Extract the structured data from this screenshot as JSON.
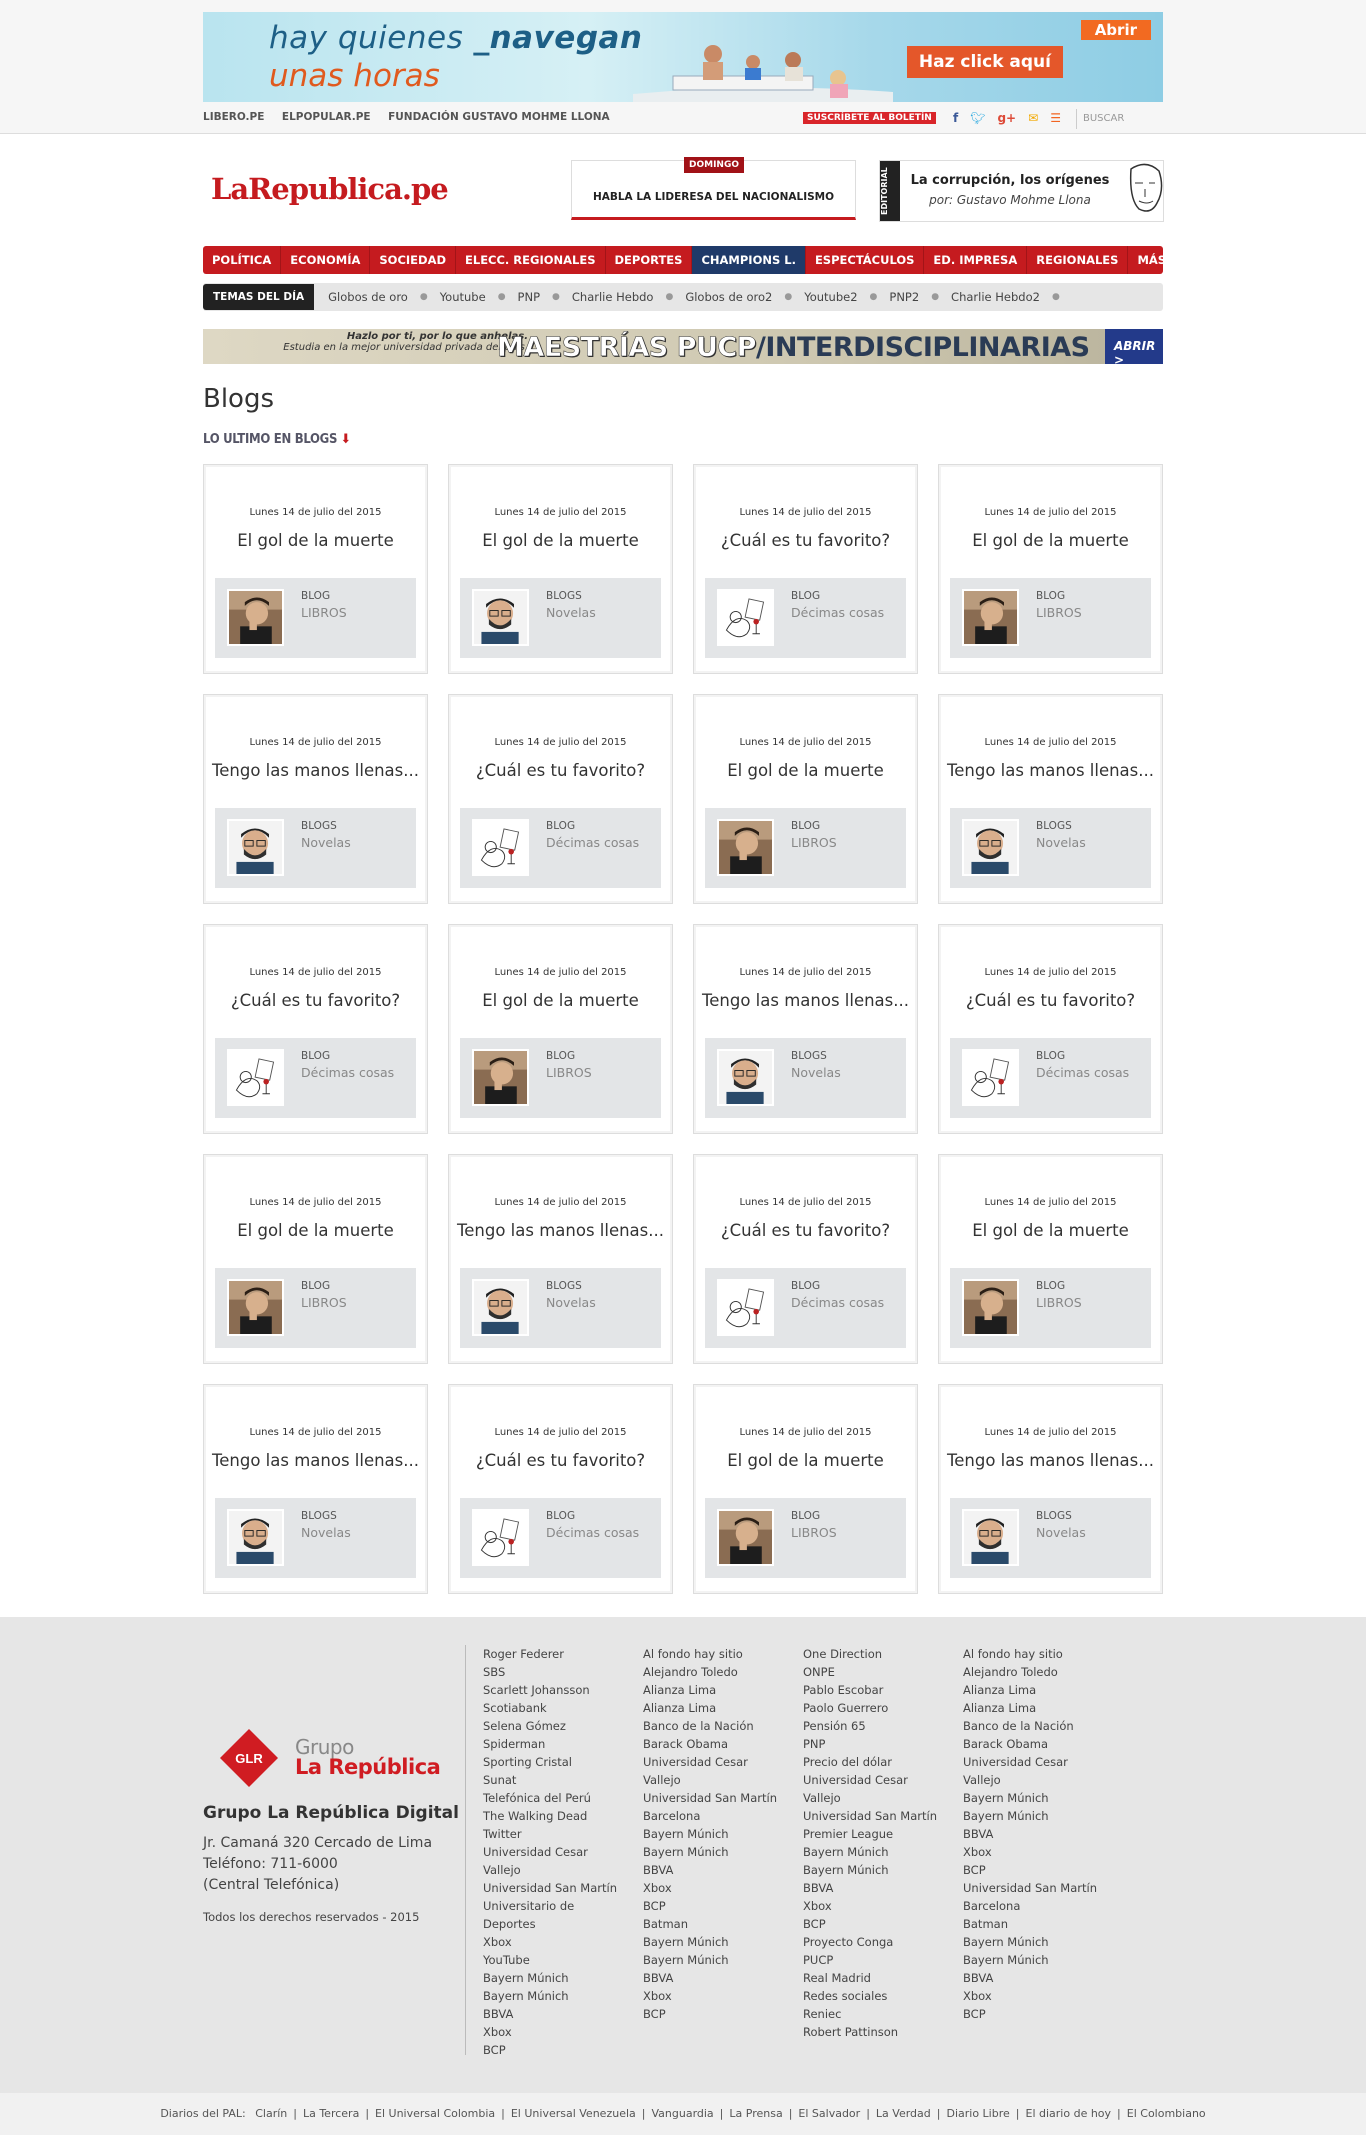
{
  "ad_top": {
    "line1a": "hay quienes ",
    "line1b": "_navegan",
    "line2": "unas horas",
    "abrir": "Abrir",
    "cta": "Haz click aquí"
  },
  "util": {
    "links": [
      "LIBERO.PE",
      "ELPOPULAR.PE",
      "FUNDACIÓN GUSTAVO MOHME LLONA"
    ],
    "subscribe": "SUSCRÍBETE AL BOLETÍN",
    "search_placeholder": "BUSCAR"
  },
  "brand": {
    "logo": "LaRepublica.pe"
  },
  "domingo": {
    "tag": "DOMINGO",
    "headline": "HABLA LA LIDERESA DEL NACIONALISMO"
  },
  "editorial": {
    "side": "EDITORIAL",
    "title": "La corrupción, los orígenes",
    "byline": "por: Gustavo Mohme Llona"
  },
  "nav": [
    "POLÍTICA",
    "ECONOMÍA",
    "SOCIEDAD",
    "ELECC. REGIONALES",
    "DEPORTES",
    "CHAMPIONS L.",
    "ESPECTÁCULOS",
    "ED. IMPRESA",
    "REGIONALES",
    "MÁS SECCIONES"
  ],
  "temas": {
    "label": "TEMAS DEL DÍA",
    "items": [
      "Globos de oro",
      "Youtube",
      "PNP",
      "Charlie Hebdo",
      "Globos de oro2",
      "Youtube2",
      "PNP2",
      "Charlie Hebdo2"
    ]
  },
  "ad2": {
    "small1": "Hazlo por ti, por lo que anhelas.",
    "small2": "Estudia en la mejor universidad privada del país.",
    "big1": "MAESTRÍAS PUCP",
    "big2": "/INTERDISCIPLINARIAS",
    "abrir": "ABRIR >"
  },
  "page": {
    "title": "Blogs",
    "section": "LO ULTIMO EN BLOGS"
  },
  "cards": [
    {
      "date": "Lunes 14 de julio del 2015",
      "title": "El gol de la muerte",
      "kind": "BLOG",
      "name": "LIBROS",
      "avatar": "a"
    },
    {
      "date": "Lunes 14 de julio del 2015",
      "title": "El gol de la muerte",
      "kind": "BLOGS",
      "name": "Novelas",
      "avatar": "b"
    },
    {
      "date": "Lunes 14 de julio del 2015",
      "title": "¿Cuál es tu favorito?",
      "kind": "BLOG",
      "name": "Décimas cosas",
      "avatar": "c"
    },
    {
      "date": "Lunes 14 de julio del 2015",
      "title": "El gol de la muerte",
      "kind": "BLOG",
      "name": "LIBROS",
      "avatar": "a"
    },
    {
      "date": "Lunes 14 de julio del 2015",
      "title": "Tengo las manos llenas...",
      "kind": "BLOGS",
      "name": "Novelas",
      "avatar": "b"
    },
    {
      "date": "Lunes 14 de julio del 2015",
      "title": "¿Cuál es tu favorito?",
      "kind": "BLOG",
      "name": "Décimas cosas",
      "avatar": "c"
    },
    {
      "date": "Lunes 14 de julio del 2015",
      "title": "El gol de la muerte",
      "kind": "BLOG",
      "name": "LIBROS",
      "avatar": "a"
    },
    {
      "date": "Lunes 14 de julio del 2015",
      "title": "Tengo las manos llenas...",
      "kind": "BLOGS",
      "name": "Novelas",
      "avatar": "b"
    },
    {
      "date": "Lunes 14 de julio del 2015",
      "title": "¿Cuál es tu favorito?",
      "kind": "BLOG",
      "name": "Décimas cosas",
      "avatar": "c"
    },
    {
      "date": "Lunes 14 de julio del 2015",
      "title": "El gol de la muerte",
      "kind": "BLOG",
      "name": "LIBROS",
      "avatar": "a"
    },
    {
      "date": "Lunes 14 de julio del 2015",
      "title": "Tengo las manos llenas...",
      "kind": "BLOGS",
      "name": "Novelas",
      "avatar": "b"
    },
    {
      "date": "Lunes 14 de julio del 2015",
      "title": "¿Cuál es tu favorito?",
      "kind": "BLOG",
      "name": "Décimas cosas",
      "avatar": "c"
    },
    {
      "date": "Lunes 14 de julio del 2015",
      "title": "El gol de la muerte",
      "kind": "BLOG",
      "name": "LIBROS",
      "avatar": "a"
    },
    {
      "date": "Lunes 14 de julio del 2015",
      "title": "Tengo las manos llenas...",
      "kind": "BLOGS",
      "name": "Novelas",
      "avatar": "b"
    },
    {
      "date": "Lunes 14 de julio del 2015",
      "title": "¿Cuál es tu favorito?",
      "kind": "BLOG",
      "name": "Décimas cosas",
      "avatar": "c"
    },
    {
      "date": "Lunes 14 de julio del 2015",
      "title": "El gol de la muerte",
      "kind": "BLOG",
      "name": "LIBROS",
      "avatar": "a"
    },
    {
      "date": "Lunes 14 de julio del 2015",
      "title": "Tengo las manos llenas...",
      "kind": "BLOGS",
      "name": "Novelas",
      "avatar": "b"
    },
    {
      "date": "Lunes 14 de julio del 2015",
      "title": "¿Cuál es tu favorito?",
      "kind": "BLOG",
      "name": "Décimas cosas",
      "avatar": "c"
    },
    {
      "date": "Lunes 14 de julio del 2015",
      "title": "El gol de la muerte",
      "kind": "BLOG",
      "name": "LIBROS",
      "avatar": "a"
    },
    {
      "date": "Lunes 14 de julio del 2015",
      "title": "Tengo las manos llenas...",
      "kind": "BLOGS",
      "name": "Novelas",
      "avatar": "b"
    }
  ],
  "footer": {
    "grupo1": "Grupo",
    "grupo2": "La República",
    "glr": "GLR",
    "name": "Grupo La República Digital",
    "addr1": "Jr. Camaná 320 Cercado de Lima",
    "addr2": "Teléfono: 711-6000",
    "addr3": "(Central Telefónica)",
    "rights": "Todos los derechos reservados - 2015",
    "cols": [
      [
        "Roger Federer",
        "SBS",
        "Scarlett Johansson",
        "Scotiabank",
        "Selena Gómez",
        "Spiderman",
        "Sporting Cristal",
        "Sunat",
        "Telefónica del Perú",
        "The Walking Dead",
        "Twitter",
        "Universidad Cesar",
        "Vallejo",
        "Universidad San Martín",
        "Universitario de",
        "Deportes",
        "Xbox",
        "YouTube",
        "Bayern Múnich",
        "Bayern Múnich",
        "BBVA",
        "Xbox",
        "BCP"
      ],
      [
        "Al fondo hay sitio",
        "Alejandro Toledo",
        "Alianza Lima",
        "Alianza Lima",
        "Banco de la Nación",
        "Barack Obama",
        "Universidad Cesar",
        "Vallejo",
        "Universidad San Martín",
        "Barcelona",
        "Bayern Múnich",
        "Bayern Múnich",
        "BBVA",
        "Xbox",
        "BCP",
        "Batman",
        "Bayern Múnich",
        "Bayern Múnich",
        "BBVA",
        "Xbox",
        "BCP"
      ],
      [
        "One Direction",
        "ONPE",
        "Pablo Escobar",
        "Paolo Guerrero",
        "Pensión 65",
        "PNP",
        "Precio del dólar",
        "Universidad Cesar",
        "Vallejo",
        "Universidad San Martín",
        "Premier League",
        "Bayern Múnich",
        "Bayern Múnich",
        "BBVA",
        "Xbox",
        "BCP",
        "Proyecto Conga",
        "PUCP",
        "Real Madrid",
        "Redes sociales",
        "Reniec",
        "Robert Pattinson"
      ],
      [
        "Al fondo hay sitio",
        "Alejandro Toledo",
        "Alianza Lima",
        "Alianza Lima",
        "Banco de la Nación",
        "Barack Obama",
        "Universidad Cesar",
        "Vallejo",
        "Bayern Múnich",
        "Bayern Múnich",
        "BBVA",
        "Xbox",
        "BCP",
        "Universidad San Martín",
        "Barcelona",
        "Batman",
        "Bayern Múnich",
        "Bayern Múnich",
        "BBVA",
        "Xbox",
        "BCP"
      ]
    ]
  },
  "bottom": {
    "label": "Diarios del PAL:",
    "items": [
      "Clarín",
      "La Tercera",
      "El Universal Colombia",
      "El Universal Venezuela",
      "Vanguardia",
      "La Prensa",
      "El Salvador",
      "La Verdad",
      "Diario Libre",
      "El diario de hoy",
      "El Colombiano"
    ]
  }
}
